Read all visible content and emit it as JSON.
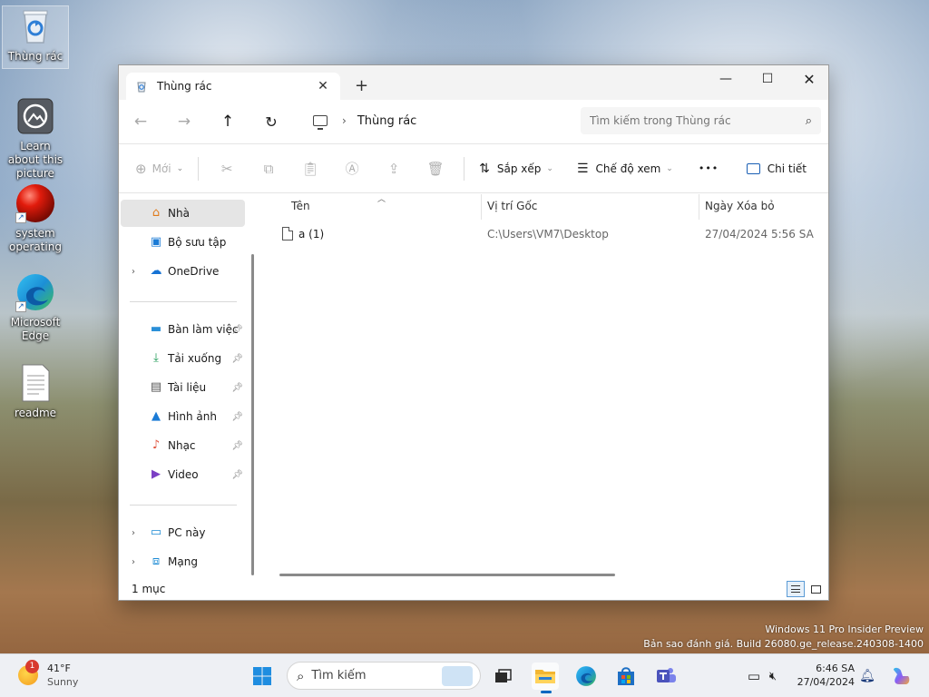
{
  "desktop": {
    "icons": [
      {
        "label": "Thùng rác"
      },
      {
        "label": "Learn about this picture"
      },
      {
        "label": "system operating"
      },
      {
        "label": "Microsoft Edge"
      },
      {
        "label": "readme"
      }
    ],
    "watermark_line1": "Windows 11 Pro Insider Preview",
    "watermark_line2": "Bản sao đánh giá. Build 26080.ge_release.240308-1400"
  },
  "window": {
    "tab_title": "Thùng rác",
    "tab_close": "✕",
    "new_tab": "+",
    "controls": {
      "minimize": "—",
      "maximize": "☐",
      "close": "✕"
    },
    "nav": {
      "back": "←",
      "forward": "→",
      "up": "↑",
      "refresh": "↻"
    },
    "address": {
      "separator": "›",
      "path": "Thùng rác"
    },
    "search": {
      "placeholder": "Tìm kiếm trong Thùng rác"
    },
    "toolbar": {
      "new_label": "Mới",
      "sort_label": "Sắp xếp",
      "view_label": "Chế độ xem",
      "more": "•••",
      "details_label": "Chi tiết"
    },
    "nav_pane": {
      "home": "Nhà",
      "gallery": "Bộ sưu tập",
      "onedrive": "OneDrive",
      "pinned": [
        {
          "label": "Bàn làm việc"
        },
        {
          "label": "Tải xuống"
        },
        {
          "label": "Tài liệu"
        },
        {
          "label": "Hình ảnh"
        },
        {
          "label": "Nhạc"
        },
        {
          "label": "Video"
        }
      ],
      "this_pc": "PC này",
      "network": "Mạng"
    },
    "columns": [
      "Tên",
      "Vị trí Gốc",
      "Ngày Xóa bỏ"
    ],
    "rows": [
      {
        "name": "a (1)",
        "location": "C:\\Users\\VM7\\Desktop",
        "deleted": "27/04/2024 5:56 SA"
      }
    ],
    "status": "1 mục"
  },
  "taskbar": {
    "weather_temp": "41°F",
    "weather_cond": "Sunny",
    "weather_badge": "1",
    "search_label": "Tìm kiếm",
    "time": "6:46 SA",
    "date": "27/04/2024"
  }
}
